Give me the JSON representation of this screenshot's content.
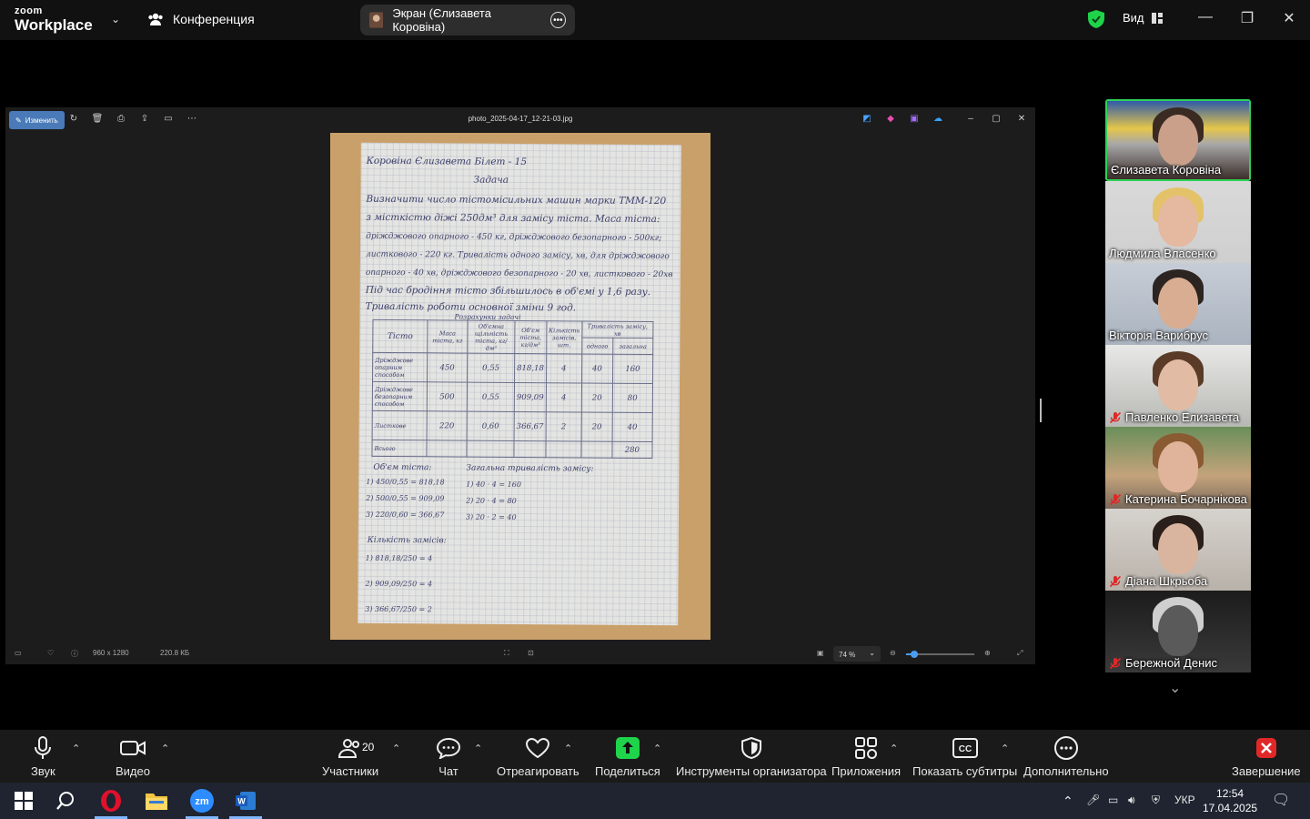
{
  "topbar": {
    "logo_line1": "zoom",
    "logo_line2": "Workplace",
    "meeting_label": "Конференция",
    "share_label": "Экран (Єлизавета Коровіна)",
    "view_label": "Вид"
  },
  "viewer": {
    "edit_label": "Изменить",
    "filename": "photo_2025-04-17_12-21-03.jpg",
    "dimensions": "960 x 1280",
    "filesize": "220.8 КБ",
    "zoom_level": "74 %",
    "zoom_fraction": 0.12
  },
  "paper": {
    "line1": "Коровіна Єлизавета   Білет - 15",
    "line2": "Задача",
    "line3": "Визначити число тістомісильних машин марки ТММ-120",
    "line4": "з місткістю діжі 250дм³ для замісу тіста. Маса тіста:",
    "line5": "дріжджового опарного - 450 кг, дріжджового безопарного - 500кг;",
    "line6": "листкового - 220 кг. Тривалість одного замісу, хв, для дріжджового",
    "line7": "опарного - 40 хв, дріжджового   безопарного - 20 хв, листкового - 20хв",
    "line8": "Під час бродіння тісто збільшилось в об'ємі у 1,6 разу.",
    "line9": "Тривалість роботи основної зміни 9 год.",
    "table_caption": "Розрахунки задачі",
    "table_headers": [
      "Тісто",
      "Маса тіста, кг",
      "Об'ємна щільність тіста, кг/дм³",
      "Об'єм тіста, кг/дм³",
      "Кількість замісів, шт.",
      "одного",
      "загальна"
    ],
    "table_header_group": "Тривалість замісу, хв",
    "table_rows": [
      [
        "Дріжджове опарним способом",
        "450",
        "0,55",
        "818,18",
        "4",
        "40",
        "160"
      ],
      [
        "Дріжджове безопарним способом",
        "500",
        "0,55",
        "909,09",
        "4",
        "20",
        "80"
      ],
      [
        "Листкове",
        "220",
        "0,60",
        "366,67",
        "2",
        "20",
        "40"
      ],
      [
        "Всього",
        "",
        "",
        "",
        "",
        "",
        "280"
      ]
    ],
    "calc_volume_title": "Об'єм тіста:",
    "calc_volume": [
      "1) 450/0,55 = 818,18",
      "2) 500/0,55 = 909,09",
      "3) 220/0,60 = 366,67"
    ],
    "calc_total_title": "Загальна тривалість замісу:",
    "calc_total": [
      "1) 40 · 4 = 160",
      "2) 20 · 4 = 80",
      "3) 20 · 2 = 40"
    ],
    "calc_count_title": "Кількість замісів:",
    "calc_count": [
      "1) 818,18/250 = 4",
      "2) 909,09/250 = 4",
      "3) 366,67/250 = 2"
    ]
  },
  "participants": [
    {
      "name": "Єлизавета Коровіна",
      "muted": false,
      "active": true
    },
    {
      "name": "Людмила Власенко",
      "muted": false,
      "active": false
    },
    {
      "name": "Вікторія Варибрус",
      "muted": false,
      "active": false
    },
    {
      "name": "Павленко Елизавета",
      "muted": true,
      "active": false
    },
    {
      "name": "Катерина Бочарнікова",
      "muted": true,
      "active": false
    },
    {
      "name": "Діана Шкрьоба",
      "muted": true,
      "active": false
    },
    {
      "name": "Бережной Денис",
      "muted": true,
      "active": false
    }
  ],
  "controls": {
    "audio": "Звук",
    "video": "Видео",
    "participants": "Участники",
    "participants_count": "20",
    "chat": "Чат",
    "react": "Отреагировать",
    "share": "Поделиться",
    "host_tools": "Инструменты организатора",
    "apps": "Приложения",
    "captions": "Показать субтитры",
    "more": "Дополнительно",
    "end": "Завершение"
  },
  "taskbar": {
    "language": "УКР",
    "time": "12:54",
    "date": "17.04.2025"
  },
  "colors": {
    "share_green": "#1fd34a",
    "active_border": "#30d158",
    "end_red": "#e02828",
    "edit_blue": "#4a7ab8"
  }
}
